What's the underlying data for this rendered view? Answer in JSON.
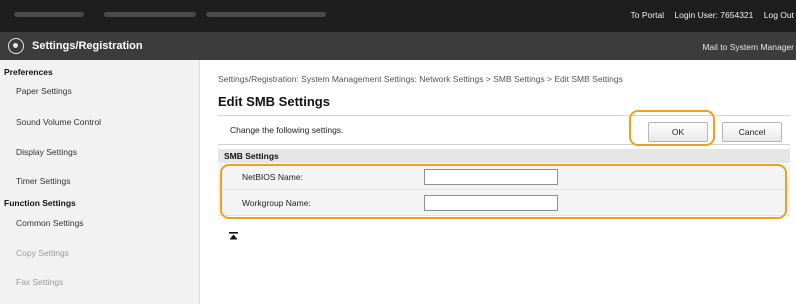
{
  "topbar": {
    "portal_link": "To Portal",
    "login_user": "Login User: 7654321",
    "logout_link": "Log Out"
  },
  "titlebar": {
    "title": "Settings/Registration",
    "mail_link": "Mail to System Manager",
    "logo_icon": "settings-gear-icon"
  },
  "sidebar": {
    "preferences_heading": "Preferences",
    "preferences_items": [
      "Paper Settings",
      "Sound Volume Control",
      "Display Settings",
      "Timer Settings"
    ],
    "function_heading": "Function Settings",
    "function_items": [
      "Common Settings",
      "Copy Settings",
      "Fax Settings"
    ]
  },
  "main": {
    "breadcrumb": "Settings/Registration: System Management Settings: Network Settings > SMB Settings > Edit SMB Settings",
    "page_title": "Edit SMB Settings",
    "instruction": "Change the following settings.",
    "ok_label": "OK",
    "cancel_label": "Cancel",
    "section_title": "SMB Settings",
    "fields": [
      {
        "label": "NetBIOS Name:",
        "value": ""
      },
      {
        "label": "Workgroup Name:",
        "value": ""
      }
    ],
    "to_top_icon": "to-top-arrow-icon"
  },
  "colors": {
    "topbar_bg": "#1e1e1e",
    "titlebar_bg": "#3c3c3c",
    "highlight": "#f0a020",
    "sidebar_bg": "#f2f2f2"
  }
}
